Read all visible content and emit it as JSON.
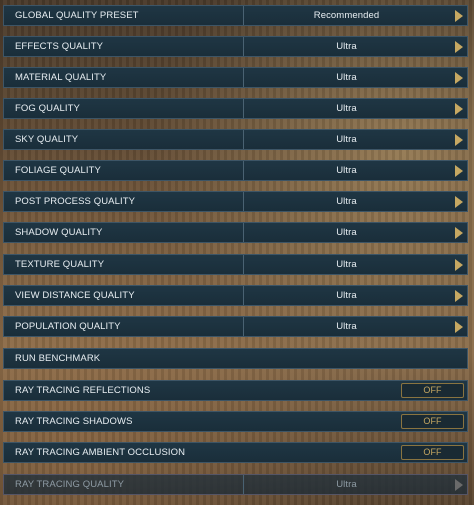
{
  "settings": [
    {
      "label": "GLOBAL QUALITY PRESET",
      "value": "Recommended"
    },
    {
      "label": "EFFECTS QUALITY",
      "value": "Ultra"
    },
    {
      "label": "MATERIAL QUALITY",
      "value": "Ultra"
    },
    {
      "label": "FOG QUALITY",
      "value": "Ultra"
    },
    {
      "label": "SKY QUALITY",
      "value": "Ultra"
    },
    {
      "label": "FOLIAGE QUALITY",
      "value": "Ultra"
    },
    {
      "label": "POST PROCESS QUALITY",
      "value": "Ultra"
    },
    {
      "label": "SHADOW QUALITY",
      "value": "Ultra"
    },
    {
      "label": "TEXTURE QUALITY",
      "value": "Ultra"
    },
    {
      "label": "VIEW DISTANCE QUALITY",
      "value": "Ultra"
    },
    {
      "label": "POPULATION QUALITY",
      "value": "Ultra"
    }
  ],
  "benchmark": {
    "label": "RUN BENCHMARK"
  },
  "toggles": [
    {
      "label": "RAY TRACING REFLECTIONS",
      "value": "OFF"
    },
    {
      "label": "RAY TRACING SHADOWS",
      "value": "OFF"
    },
    {
      "label": "RAY TRACING AMBIENT OCCLUSION",
      "value": "OFF"
    }
  ],
  "disabled_setting": {
    "label": "RAY TRACING QUALITY",
    "value": "Ultra"
  },
  "colors": {
    "row_bg": "#1f3644",
    "accent_gold": "#c6a862",
    "text": "#e8eef2"
  },
  "icons": {
    "arrow": "chevron-right-icon"
  }
}
